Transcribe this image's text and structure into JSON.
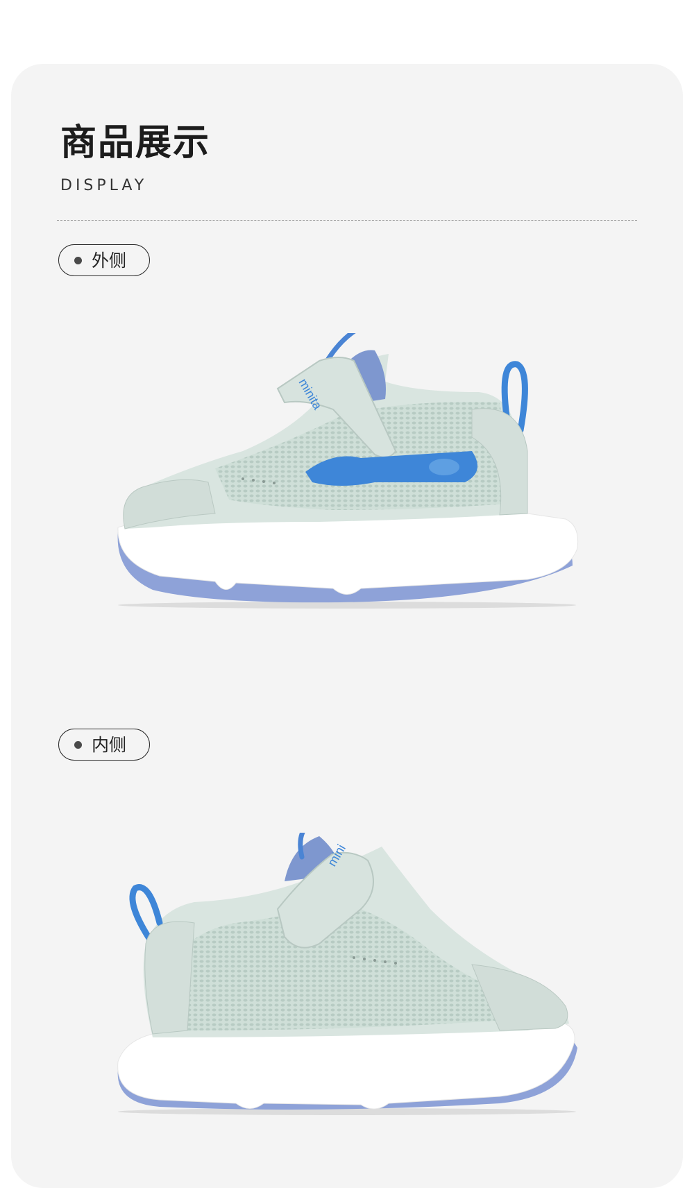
{
  "section": {
    "title": "商品展示",
    "subtitle": "DISPLAY"
  },
  "views": [
    {
      "label": "外侧",
      "image": "shoe-lateral-side",
      "brand_mark": "minita"
    },
    {
      "label": "内侧",
      "image": "shoe-medial-side",
      "brand_mark": "mini"
    }
  ],
  "colors": {
    "card": "#f4f4f4",
    "upper": "#d9e5e0",
    "mesh": "#c8d9d2",
    "accent_blue": "#3e86d8",
    "lining_blue": "#7e97cf",
    "sole": "#ffffff",
    "outsole": "#8ea2d8"
  }
}
